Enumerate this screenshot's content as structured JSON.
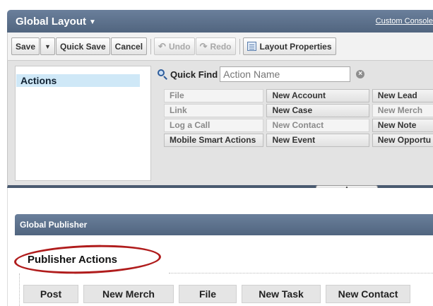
{
  "header": {
    "title": "Global Layout",
    "custom_console_link": "Custom Console"
  },
  "toolbar": {
    "save_label": "Save",
    "quick_save_label": "Quick Save",
    "cancel_label": "Cancel",
    "undo_label": "Undo",
    "redo_label": "Redo",
    "layout_properties_label": "Layout Properties"
  },
  "palette": {
    "categories": [
      "Actions"
    ],
    "quick_find": {
      "label": "Quick Find",
      "placeholder": "Action Name"
    },
    "items": [
      [
        "File",
        "New Account",
        "New Lead"
      ],
      [
        "Link",
        "New Case",
        "New Merch"
      ],
      [
        "Log a Call",
        "New Contact",
        "New Note"
      ],
      [
        "Mobile Smart Actions",
        "New Event",
        "New Opportu"
      ]
    ],
    "used_items": [
      "File",
      "Link",
      "Log a Call",
      "New Contact",
      "New Merch"
    ]
  },
  "global_publisher": {
    "title": "Global Publisher",
    "section_title": "Publisher Actions",
    "actions": [
      "Post",
      "New Merch",
      "File",
      "New Task",
      "New Contact"
    ]
  },
  "icons": {
    "dropdown": "chevron-down-icon",
    "undo": "undo-icon",
    "redo": "redo-icon",
    "layout_properties": "layout-properties-icon",
    "search": "magnifier-icon",
    "clear": "clear-icon"
  },
  "colors": {
    "header_bg": "#5b6f8a",
    "selected_category_bg": "#cfe8f7",
    "highlight_oval": "#b01c1c"
  }
}
